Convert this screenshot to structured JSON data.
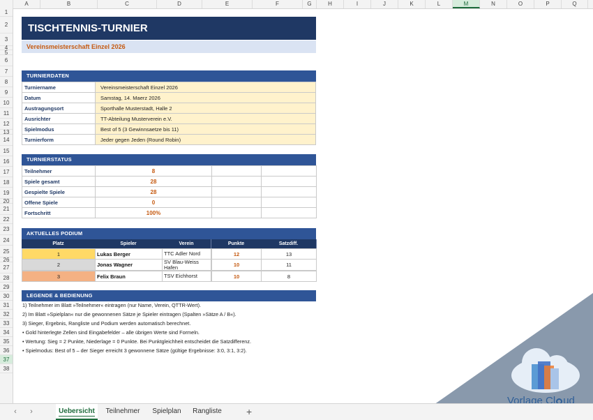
{
  "columns": [
    "A",
    "B",
    "C",
    "D",
    "E",
    "F",
    "G",
    "H",
    "I",
    "J",
    "K",
    "L",
    "M",
    "N",
    "O",
    "P",
    "Q"
  ],
  "selected_column": "M",
  "rows": [
    "1",
    "2",
    "3",
    "4",
    "5",
    "6",
    "7",
    "8",
    "9",
    "10",
    "11",
    "12",
    "13",
    "14",
    "15",
    "16",
    "17",
    "18",
    "19",
    "20",
    "21",
    "22",
    "23",
    "24",
    "25",
    "26",
    "27",
    "28",
    "29",
    "30",
    "31",
    "32",
    "33",
    "34",
    "35",
    "36",
    "37",
    "38"
  ],
  "selected_row": "37",
  "header": {
    "title": "TISCHTENNIS-TURNIER",
    "subtitle": "Vereinsmeisterschaft Einzel 2026"
  },
  "turnierdaten": {
    "section": "TURNIERDATEN",
    "rows": [
      {
        "label": "Turniername",
        "value": "Vereinsmeisterschaft Einzel 2026"
      },
      {
        "label": "Datum",
        "value": "Samstag, 14. Maerz 2026"
      },
      {
        "label": "Austragungsort",
        "value": "Sporthalle Musterstadt, Halle 2"
      },
      {
        "label": "Ausrichter",
        "value": "TT-Abteilung Musterverein e.V."
      },
      {
        "label": "Spielmodus",
        "value": "Best of 5 (3 Gewinnsaetze bis 11)"
      },
      {
        "label": "Turnierform",
        "value": "Jeder gegen Jeden (Round Robin)"
      }
    ]
  },
  "turnierstatus": {
    "section": "TURNIERSTATUS",
    "rows": [
      {
        "label": "Teilnehmer",
        "value": "8"
      },
      {
        "label": "Spiele gesamt",
        "value": "28"
      },
      {
        "label": "Gespielte Spiele",
        "value": "28"
      },
      {
        "label": "Offene Spiele",
        "value": "0"
      },
      {
        "label": "Fortschritt",
        "value": "100%"
      }
    ]
  },
  "podium": {
    "section": "AKTUELLES PODIUM",
    "headers": [
      "Platz",
      "Spieler",
      "Verein",
      "Punkte",
      "Satzdiff."
    ],
    "rows": [
      {
        "platz": "1",
        "spieler": "Lukas Berger",
        "verein": "TTC Adler Nord",
        "punkte": "12",
        "diff": "13",
        "color": "#ffd966"
      },
      {
        "platz": "2",
        "spieler": "Jonas Wagner",
        "verein": "SV Blau-Weiss Hafen",
        "punkte": "10",
        "diff": "11",
        "color": "#d9d9d9"
      },
      {
        "platz": "3",
        "spieler": "Felix Braun",
        "verein": "TSV Eichhorst",
        "punkte": "10",
        "diff": "8",
        "color": "#f4b183"
      }
    ]
  },
  "legende": {
    "section": "LEGENDE & BEDIENUNG",
    "items": [
      "1)  Teilnehmer im Blatt »Teilnehmer« eintragen (nur Name, Verein, QTTR-Wert).",
      "2)  Im Blatt »Spielplan« nur die gewonnenen Sätze je Spieler eintragen (Spalten »Sätze A / B«).",
      "3)  Sieger, Ergebnis, Rangliste und Podium werden automatisch berechnet.",
      "•  Gold hinterlegte Zellen sind Eingabefelder – alle übrigen Werte sind Formeln.",
      "•  Wertung: Sieg = 2 Punkte, Niederlage = 0 Punkte. Bei Punktgleichheit entscheidet die Satzdifferenz.",
      "•  Spielmodus: Best of 5 – der Sieger erreicht 3 gewonnene Sätze (gültige Ergebnisse: 3:0, 3:1, 3:2)."
    ]
  },
  "sheet_tabs": {
    "items": [
      "Uebersicht",
      "Teilnehmer",
      "Spielplan",
      "Rangliste"
    ],
    "active": "Uebersicht",
    "add_label": "+",
    "prev_label": "‹",
    "next_label": "›"
  },
  "watermark": {
    "brand_part1": "Vorlage",
    "brand_part2": "Cl",
    "brand_part3": "ud"
  },
  "colors": {
    "title_bg": "#1f3864",
    "section_bg": "#2f5597",
    "input_fill": "#fff2cc",
    "accent_orange": "#c55a11",
    "excel_green": "#1d6b3b"
  }
}
